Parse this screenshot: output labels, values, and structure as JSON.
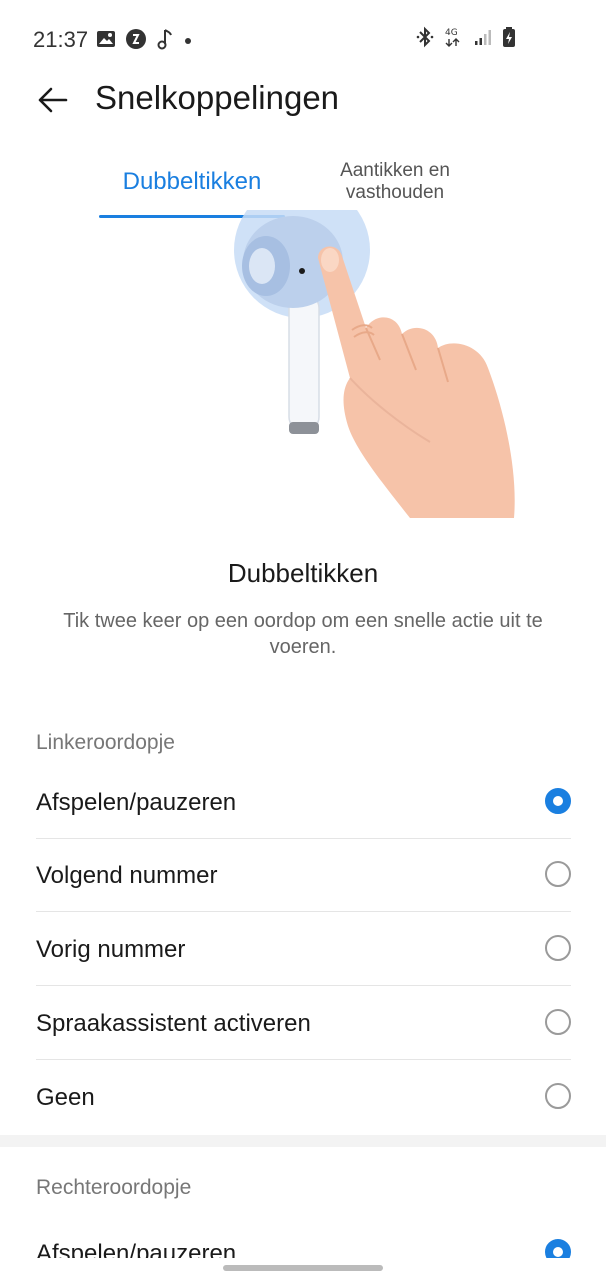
{
  "status_bar": {
    "time": "21:37",
    "left_icons": [
      "gallery-icon",
      "dark-circle-icon",
      "music-note-icon",
      "dot-icon"
    ],
    "right_icons": [
      "bluetooth-icon",
      "4g-icon",
      "signal-icon",
      "battery-charging-icon"
    ],
    "network": "4G"
  },
  "app_bar": {
    "back_icon": "arrow-left-icon",
    "title": "Snelkoppelingen"
  },
  "tabs": [
    {
      "label": "Dubbeltikken",
      "selected": true
    },
    {
      "label": "Aantikken en vasthouden",
      "selected": false
    }
  ],
  "illustration": {
    "icon": "earbud-tap-illustration"
  },
  "gesture": {
    "title": "Dubbeltikken",
    "description": "Tik twee keer op een oordop om een snelle actie uit te voeren."
  },
  "left_earbud": {
    "label": "Linkeroordopje",
    "options": [
      {
        "label": "Afspelen/pauzeren",
        "selected": true
      },
      {
        "label": "Volgend nummer",
        "selected": false
      },
      {
        "label": "Vorig nummer",
        "selected": false
      },
      {
        "label": "Spraakassistent activeren",
        "selected": false
      },
      {
        "label": "Geen",
        "selected": false
      }
    ]
  },
  "right_earbud": {
    "label": "Rechteroordopje",
    "options": [
      {
        "label": "Afspelen/pauzeren",
        "selected": true
      }
    ]
  },
  "colors": {
    "accent": "#1a7fe0",
    "skin": "#f6c3a9",
    "earbud": "#c8d7ec"
  }
}
